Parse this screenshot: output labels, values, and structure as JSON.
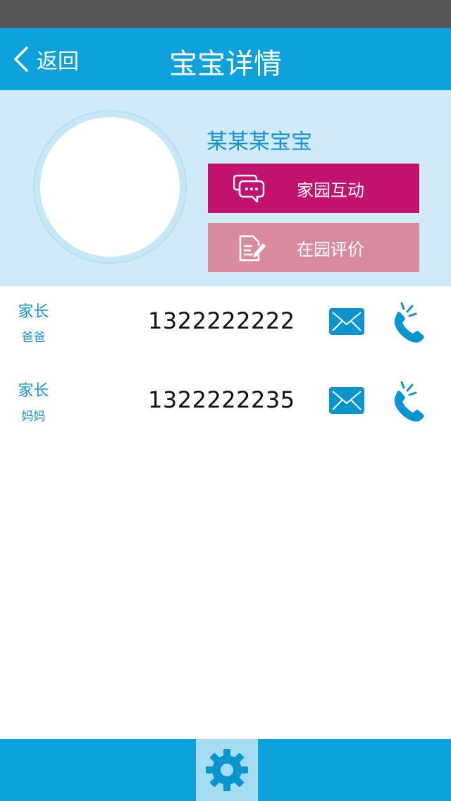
{
  "nav": {
    "back_label": "返回",
    "title": "宝宝详情"
  },
  "profile": {
    "child_name": "某某某宝宝"
  },
  "actions": {
    "interact_label": "家园互动",
    "evaluate_label": "在园评价"
  },
  "contacts": [
    {
      "role": "家长",
      "relation": "爸爸",
      "phone": "1322222222"
    },
    {
      "role": "家长",
      "relation": "妈妈",
      "phone": "1322222235"
    }
  ],
  "colors": {
    "primary": "#0ea1dc",
    "profile_bg": "#d0ebf7",
    "interact": "#c1136d",
    "evaluate": "#d98a9f",
    "accent_text": "#1595d3"
  },
  "icons": {
    "back": "chevron-left-icon",
    "interact": "chat-bubbles-icon",
    "evaluate": "document-pen-icon",
    "mail": "envelope-icon",
    "call": "phone-ringing-icon",
    "settings": "gear-icon"
  }
}
